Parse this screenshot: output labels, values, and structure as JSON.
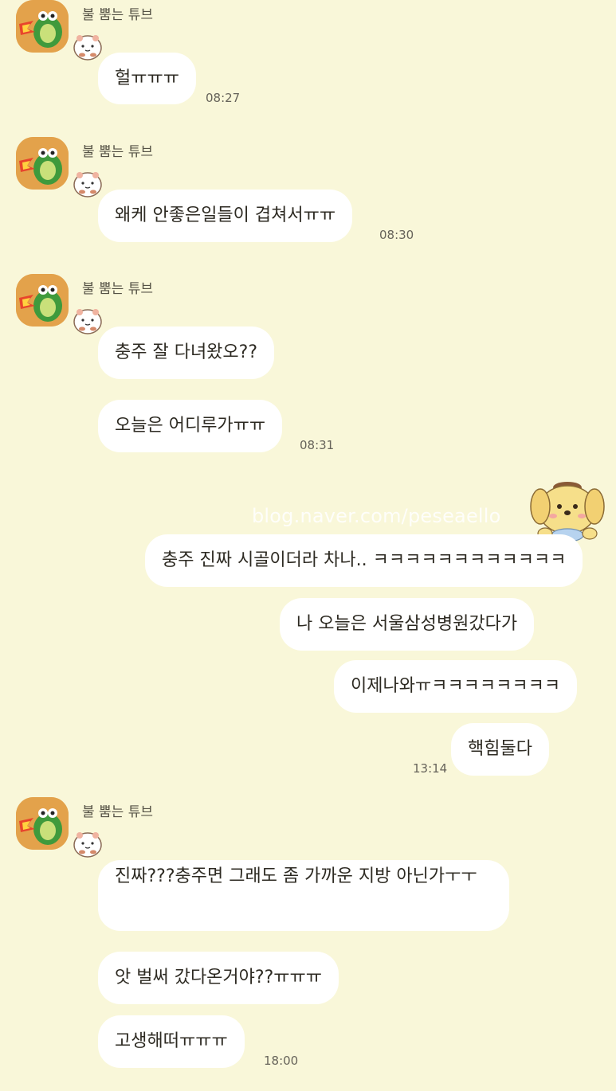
{
  "sender_name": "불 뿜는 튜브",
  "watermark": "blog.naver.com/peseaello",
  "messages": [
    {
      "text": "헐ㅠㅠㅠ",
      "time": "08:27"
    },
    {
      "text": "왜케 안좋은일들이 겹쳐서ㅠㅠ",
      "time": "08:30"
    },
    {
      "text": "충주 잘 다녀왔오??"
    },
    {
      "text": "오늘은 어디루가ㅠㅠ",
      "time": "08:31"
    },
    {
      "text": "충주 진짜 시골이더라 차나.. ㅋㅋㅋㅋㅋㅋㅋㅋㅋㅋㅋㅋ"
    },
    {
      "text": "나 오늘은 서울삼성병원갔다가"
    },
    {
      "text": "이제나와ㅠㅋㅋㅋㅋㅋㅋㅋㅋ"
    },
    {
      "text": "핵힘둘다",
      "time": "13:14"
    },
    {
      "text": "진짜???충주면 그래도 좀 가까운 지방 아닌가ㅜㅜ"
    },
    {
      "text": "앗 벌써 갔다온거야??ㅠㅠㅠ"
    },
    {
      "text": "고생해떠ㅠㅠㅠ",
      "time": "18:00"
    }
  ],
  "colors": {
    "background": "#f9f7d9",
    "bubble": "#ffffff",
    "avatar": "#e3a24b"
  },
  "icons": {
    "avatar": "fire-breathing-tube-avatar",
    "sticker": "hamster-sticker-icon",
    "character": "pompompurin-icon"
  }
}
